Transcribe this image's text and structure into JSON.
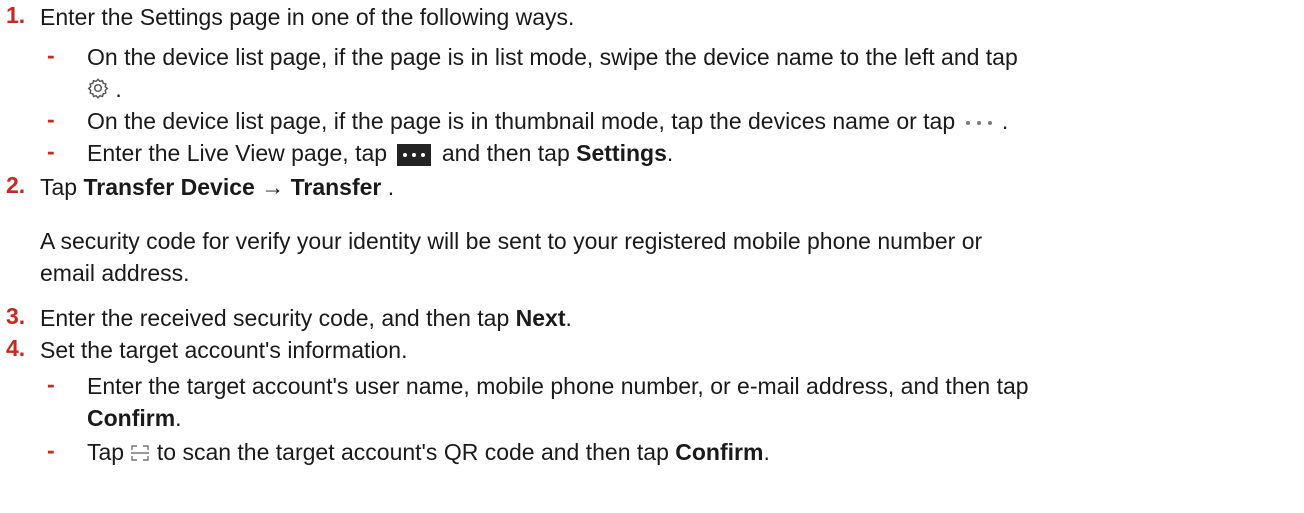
{
  "steps": [
    {
      "number": "1.",
      "text": "Enter the Settings page in one of the following ways."
    },
    {
      "number": "2.",
      "pre": "Tap ",
      "bold": "Transfer Device → Transfer",
      "post": " ."
    },
    {
      "number": "3.",
      "pre": "Enter the received security code, and then tap ",
      "bold": "Next",
      "post": "."
    },
    {
      "number": "4.",
      "text": "Set the target account's information."
    }
  ],
  "step1_subs": {
    "a_line1": "On the device list page, if the page is in list mode, swipe the device name to the left and tap",
    "a_line2_post": " .",
    "b_pre": "On the device list page, if the page is in thumbnail mode, tap the devices name or tap ",
    "b_post": " .",
    "c_pre": "Enter the Live View page, tap ",
    "c_mid": " and then tap ",
    "c_bold": "Settings",
    "c_post": "."
  },
  "step2_result": {
    "line1": "A security code for verify your identity will be sent to your registered mobile phone number or",
    "line2": "email address."
  },
  "step4_subs": {
    "a_line1": "Enter the target account's user name, mobile phone number, or e-mail address, and then tap",
    "a_line2_bold": "Confirm",
    "a_line2_post": ".",
    "b_pre": "Tap ",
    "b_mid": " to scan the target account's QR code and then tap ",
    "b_bold": "Confirm",
    "b_post": "."
  },
  "bullet_char": "-",
  "icons": {
    "settings": "gear-icon",
    "more_gray": "more-horizontal-icon",
    "more_dark": "more-horizontal-icon",
    "scan": "scan-icon"
  },
  "colors": {
    "step_number": "#c8281e",
    "text": "#1a1a1a"
  }
}
